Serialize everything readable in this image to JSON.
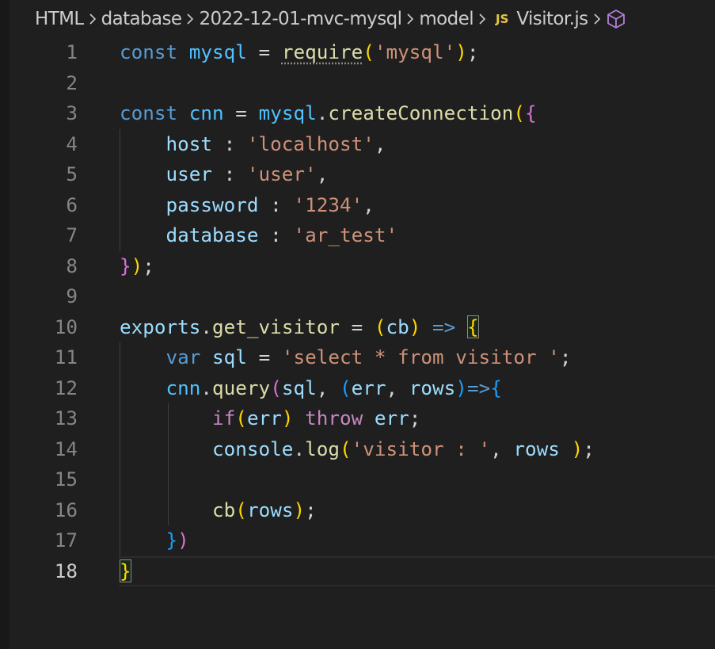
{
  "breadcrumb": {
    "items": [
      "HTML",
      "database",
      "2022-12-01-mvc-mysql",
      "model"
    ],
    "file_badge": "JS",
    "file_name": "Visitor.js",
    "symbol_icon": "cube-icon"
  },
  "editor": {
    "current_line": 18,
    "line_numbers": [
      "1",
      "2",
      "3",
      "4",
      "5",
      "6",
      "7",
      "8",
      "9",
      "10",
      "11",
      "12",
      "13",
      "14",
      "15",
      "16",
      "17",
      "18"
    ]
  },
  "colors": {
    "background": "#1f1f1f",
    "keyword": "#569cd6",
    "constant": "#4fc1ff",
    "variable": "#9cdcfe",
    "function": "#dcdcaa",
    "string": "#ce9178",
    "control": "#c586c0",
    "bracket_1": "#ffd700",
    "bracket_2": "#da70d6",
    "bracket_3": "#179fff",
    "js_badge": "#e8c545"
  },
  "code": [
    [
      [
        "k",
        "const"
      ],
      [
        "p",
        " "
      ],
      [
        "c",
        "mysql"
      ],
      [
        "p",
        " = "
      ],
      [
        "f",
        "require",
        "hint"
      ],
      [
        "b1",
        "("
      ],
      [
        "s",
        "'mysql'"
      ],
      [
        "b1",
        ")"
      ],
      [
        "p",
        ";"
      ]
    ],
    [],
    [
      [
        "k",
        "const"
      ],
      [
        "p",
        " "
      ],
      [
        "c",
        "cnn"
      ],
      [
        "p",
        " = "
      ],
      [
        "c",
        "mysql"
      ],
      [
        "p",
        "."
      ],
      [
        "f",
        "createConnection"
      ],
      [
        "b1",
        "("
      ],
      [
        "b2",
        "{"
      ]
    ],
    [
      [
        "p",
        "    "
      ],
      [
        "v",
        "host"
      ],
      [
        "p",
        " : "
      ],
      [
        "s",
        "'localhost'"
      ],
      [
        "p",
        ","
      ]
    ],
    [
      [
        "p",
        "    "
      ],
      [
        "v",
        "user"
      ],
      [
        "p",
        " : "
      ],
      [
        "s",
        "'user'"
      ],
      [
        "p",
        ","
      ]
    ],
    [
      [
        "p",
        "    "
      ],
      [
        "v",
        "password"
      ],
      [
        "p",
        " : "
      ],
      [
        "s",
        "'1234'"
      ],
      [
        "p",
        ","
      ]
    ],
    [
      [
        "p",
        "    "
      ],
      [
        "v",
        "database"
      ],
      [
        "p",
        " : "
      ],
      [
        "s",
        "'ar_test'"
      ]
    ],
    [
      [
        "b2",
        "}"
      ],
      [
        "b1",
        ")"
      ],
      [
        "p",
        ";"
      ]
    ],
    [],
    [
      [
        "v",
        "exports"
      ],
      [
        "p",
        "."
      ],
      [
        "f",
        "get_visitor"
      ],
      [
        "p",
        " = "
      ],
      [
        "b1",
        "("
      ],
      [
        "v",
        "cb"
      ],
      [
        "b1",
        ")"
      ],
      [
        "p",
        " "
      ],
      [
        "k",
        "=>"
      ],
      [
        "p",
        " "
      ],
      [
        "b1",
        "{",
        "match"
      ]
    ],
    [
      [
        "p",
        "    "
      ],
      [
        "k",
        "var"
      ],
      [
        "p",
        " "
      ],
      [
        "v",
        "sql"
      ],
      [
        "p",
        " = "
      ],
      [
        "s",
        "'select * from visitor '"
      ],
      [
        "p",
        ";"
      ]
    ],
    [
      [
        "p",
        "    "
      ],
      [
        "c",
        "cnn"
      ],
      [
        "p",
        "."
      ],
      [
        "f",
        "query"
      ],
      [
        "b2",
        "("
      ],
      [
        "v",
        "sql"
      ],
      [
        "p",
        ", "
      ],
      [
        "b3",
        "("
      ],
      [
        "v",
        "err"
      ],
      [
        "p",
        ", "
      ],
      [
        "v",
        "rows"
      ],
      [
        "b3",
        ")"
      ],
      [
        "k",
        "=>"
      ],
      [
        "b3",
        "{"
      ]
    ],
    [
      [
        "p",
        "        "
      ],
      [
        "cf",
        "if"
      ],
      [
        "b1",
        "("
      ],
      [
        "v",
        "err"
      ],
      [
        "b1",
        ")"
      ],
      [
        "p",
        " "
      ],
      [
        "cf",
        "throw"
      ],
      [
        "p",
        " "
      ],
      [
        "v",
        "err"
      ],
      [
        "p",
        ";"
      ]
    ],
    [
      [
        "p",
        "        "
      ],
      [
        "v",
        "console"
      ],
      [
        "p",
        "."
      ],
      [
        "f",
        "log"
      ],
      [
        "b1",
        "("
      ],
      [
        "s",
        "'visitor : '"
      ],
      [
        "p",
        ", "
      ],
      [
        "v",
        "rows"
      ],
      [
        "p",
        " "
      ],
      [
        "b1",
        ")"
      ],
      [
        "p",
        ";"
      ]
    ],
    [],
    [
      [
        "p",
        "        "
      ],
      [
        "f",
        "cb"
      ],
      [
        "b1",
        "("
      ],
      [
        "v",
        "rows"
      ],
      [
        "b1",
        ")"
      ],
      [
        "p",
        ";"
      ]
    ],
    [
      [
        "p",
        "    "
      ],
      [
        "b3",
        "}"
      ],
      [
        "b2",
        ")"
      ]
    ],
    [
      [
        "b1",
        "}",
        "match"
      ]
    ]
  ]
}
